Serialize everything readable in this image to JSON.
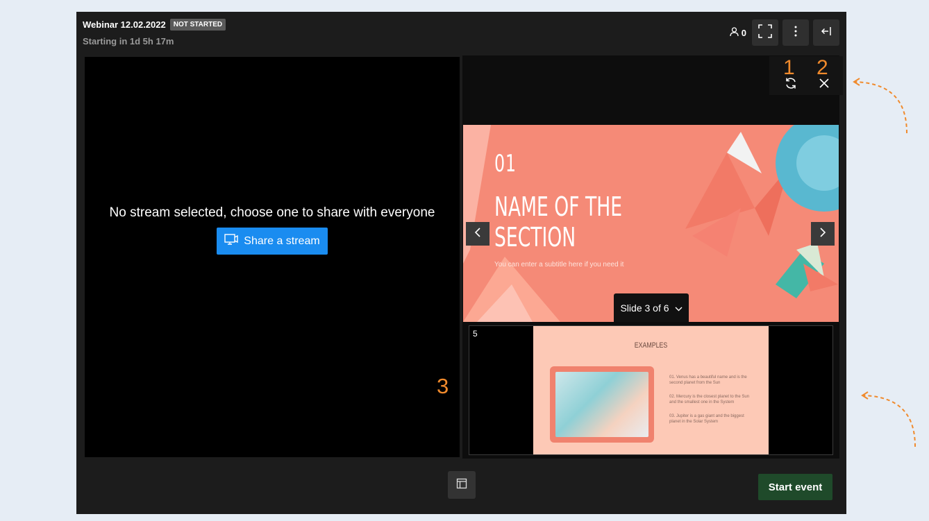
{
  "header": {
    "title": "Webinar 12.02.2022",
    "status_badge": "NOT STARTED",
    "countdown": "Starting in 1d 5h 17m",
    "attendee_count": "0"
  },
  "stream": {
    "message": "No stream selected, choose one to share with everyone",
    "share_label": "Share a stream"
  },
  "annotations": {
    "refresh_marker": "1",
    "close_marker": "2",
    "stream_marker": "3"
  },
  "slide": {
    "number": "01",
    "heading": "NAME OF THE SECTION",
    "subtitle": "You can enter a subtitle here if you need it",
    "selector_label": "Slide 3 of 6"
  },
  "thumbnail": {
    "number": "5",
    "title": "EXAMPLES",
    "points": [
      "01. Venus has a beautiful name and is the second planet from the Sun",
      "02. Mercury is the closest planet to the Sun and the smallest one in the System",
      "03. Jupiter is a gas giant and the biggest planet in the Solar System"
    ]
  },
  "footer": {
    "start_label": "Start event"
  },
  "colors": {
    "accent_blue": "#1a8cf0",
    "start_green": "#1f4a2a",
    "annotation_orange": "#f08a2c",
    "slide_coral": "#f58a77"
  }
}
